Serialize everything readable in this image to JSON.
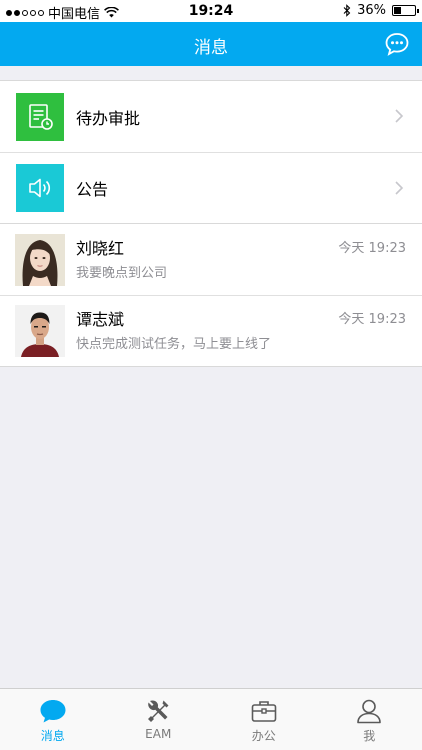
{
  "status_bar": {
    "carrier": "中国电信",
    "time": "19:24",
    "battery_percent": "36%",
    "battery_level": 0.36,
    "signal_bars": 2
  },
  "nav": {
    "title": "消息",
    "right_icon": "chat-bubble-icon"
  },
  "system_items": [
    {
      "label": "待办审批",
      "icon": "approval-document-icon",
      "color": "#2fbf3f"
    },
    {
      "label": "公告",
      "icon": "speaker-icon",
      "color": "#1ac9d6"
    }
  ],
  "messages": [
    {
      "name": "刘晓红",
      "preview": "我要晚点到公司",
      "time": "今天 19:23"
    },
    {
      "name": "谭志斌",
      "preview": "快点完成测试任务，马上要上线了",
      "time": "今天 19:23"
    }
  ],
  "tabs": [
    {
      "label": "消息",
      "icon": "message-icon",
      "active": true
    },
    {
      "label": "EAM",
      "icon": "tools-icon",
      "active": false
    },
    {
      "label": "办公",
      "icon": "briefcase-icon",
      "active": false
    },
    {
      "label": "我",
      "icon": "user-icon",
      "active": false
    }
  ],
  "colors": {
    "accent": "#03a9f0",
    "background": "#efeff4"
  }
}
